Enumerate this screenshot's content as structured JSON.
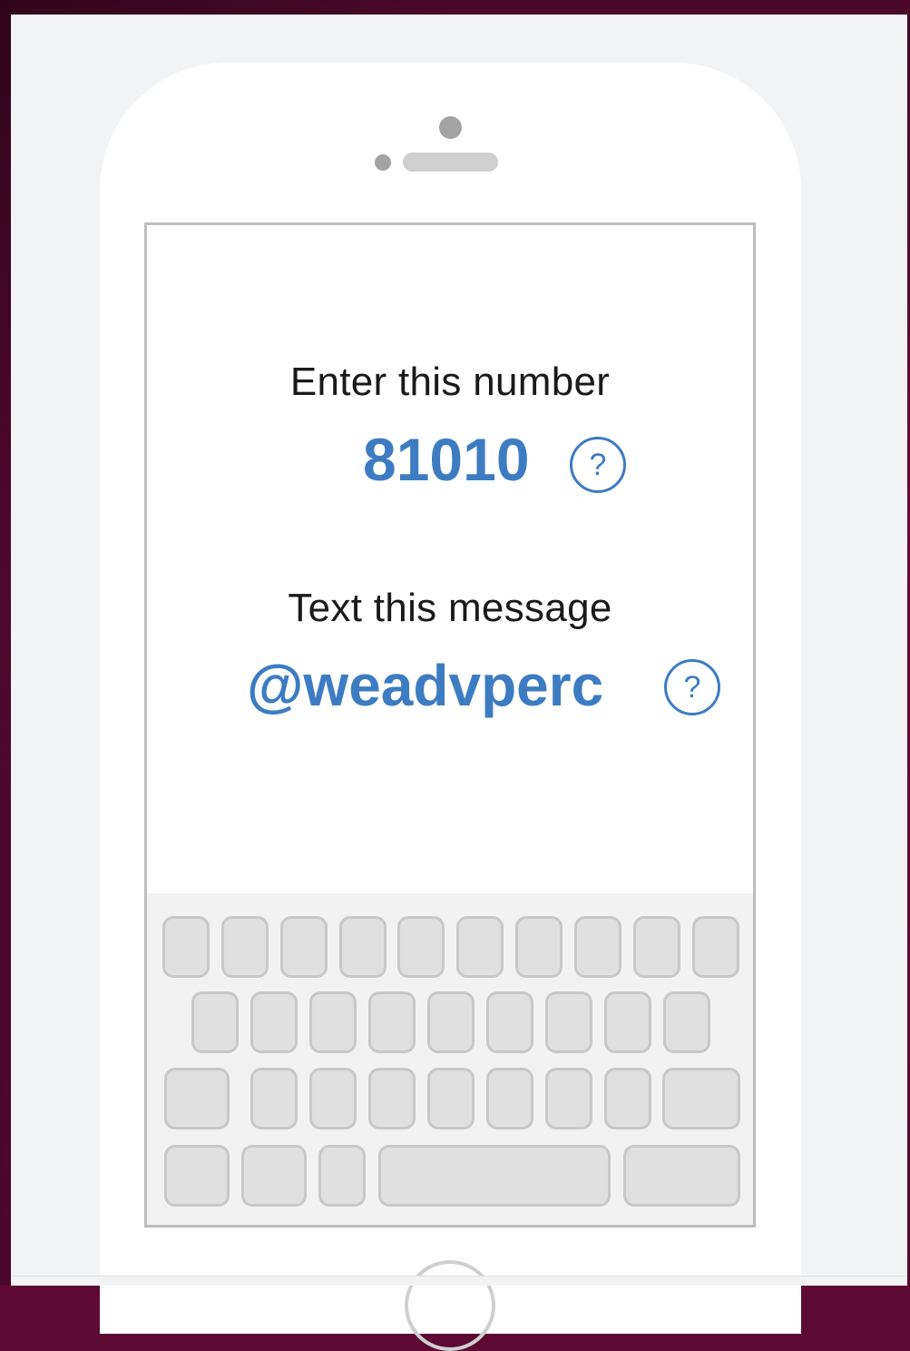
{
  "screen": {
    "number_label": "Enter this number",
    "number_value": "81010",
    "message_label": "Text this message",
    "message_value": "@weadvperc",
    "help_symbol": "?"
  },
  "icons": {
    "help": "question-circle-icon"
  },
  "colors": {
    "accent": "#3d7cc2",
    "background": "#5c0a33"
  }
}
